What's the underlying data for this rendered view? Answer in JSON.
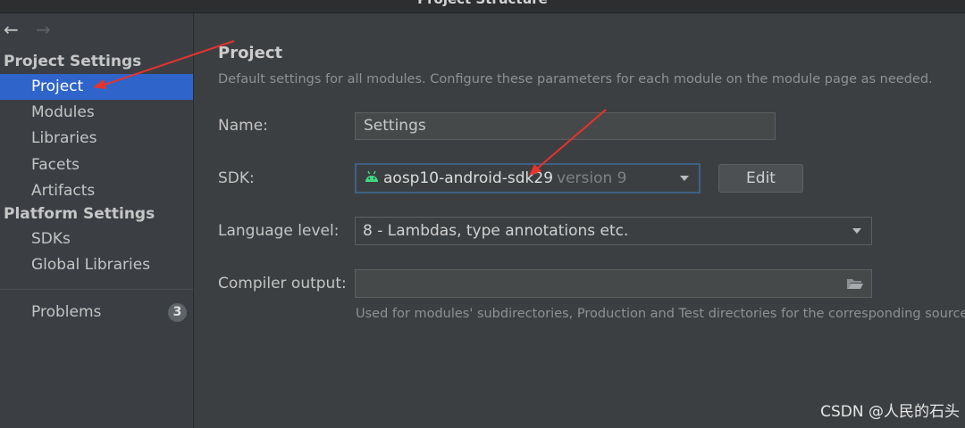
{
  "window": {
    "title": "Project Structure"
  },
  "nav": {
    "back_icon": "left-arrow-icon",
    "forward_icon": "right-arrow-icon"
  },
  "sidebar": {
    "project_settings_header": "Project Settings",
    "project_items": [
      {
        "label": "Project",
        "selected": true
      },
      {
        "label": "Modules"
      },
      {
        "label": "Libraries"
      },
      {
        "label": "Facets"
      },
      {
        "label": "Artifacts"
      }
    ],
    "platform_settings_header": "Platform Settings",
    "platform_items": [
      {
        "label": "SDKs"
      },
      {
        "label": "Global Libraries"
      }
    ],
    "problems": {
      "label": "Problems",
      "count": "3"
    }
  },
  "main": {
    "title": "Project",
    "description": "Default settings for all modules. Configure these parameters for each module on the module page as needed.",
    "name": {
      "label": "Name:",
      "value": "Settings"
    },
    "sdk": {
      "label": "SDK:",
      "value": "aosp10-android-sdk29",
      "version": "version 9",
      "icon": "android-icon",
      "edit_label": "Edit"
    },
    "language_level": {
      "label": "Language level:",
      "value": "8 - Lambdas, type annotations etc."
    },
    "compiler_output": {
      "label": "Compiler output:",
      "value": "",
      "hint": "Used for modules' subdirectories, Production and Test directories for the corresponding source"
    }
  },
  "colors": {
    "selection": "#2f65ca",
    "annotation_arrow": "#e8322c",
    "android_green": "#3ddc84"
  },
  "watermark": "CSDN @人民的石头"
}
